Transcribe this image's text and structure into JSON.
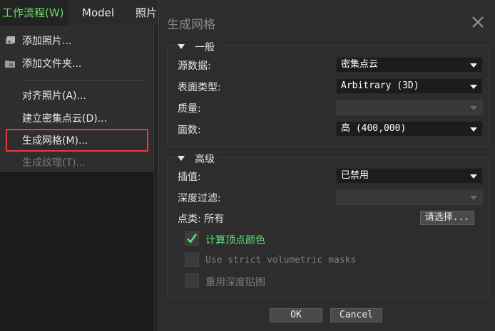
{
  "menubar": {
    "items": [
      {
        "label": "工作流程(W)"
      },
      {
        "label": "Model"
      },
      {
        "label": "照片"
      }
    ]
  },
  "workflow_menu": {
    "items": [
      {
        "label": "添加照片..."
      },
      {
        "label": "添加文件夹..."
      },
      {
        "label": "对齐照片(A)..."
      },
      {
        "label": "建立密集点云(D)..."
      },
      {
        "label": "生成网格(M)..."
      },
      {
        "label": "生成纹理(T)..."
      }
    ]
  },
  "dialog": {
    "title": "生成网格",
    "general": {
      "header": "一般",
      "source_data": {
        "label": "源数据:",
        "value": "密集点云"
      },
      "surface_type": {
        "label": "表面类型:",
        "value": "Arbitrary (3D)"
      },
      "quality": {
        "label": "质量:",
        "value": ""
      },
      "face_count": {
        "label": "面数:",
        "value": "高 (400,000)"
      }
    },
    "advanced": {
      "header": "高级",
      "interpolation": {
        "label": "插值:",
        "value": "已禁用"
      },
      "depth_filter": {
        "label": "深度过滤:",
        "value": ""
      },
      "point_classes": {
        "label": "点类: 所有",
        "button": "请选择..."
      },
      "calc_vertex_colors": {
        "label": "计算顶点颜色",
        "checked": true
      },
      "strict_masks": {
        "label": "Use strict volumetric masks",
        "checked": false
      },
      "reuse_depth_maps": {
        "label": "重用深度贴图",
        "checked": false
      }
    },
    "ok_label": "OK",
    "cancel_label": "Cancel"
  },
  "colors": {
    "accent_green": "#5fe37c",
    "highlight_red": "#e83a3a"
  }
}
